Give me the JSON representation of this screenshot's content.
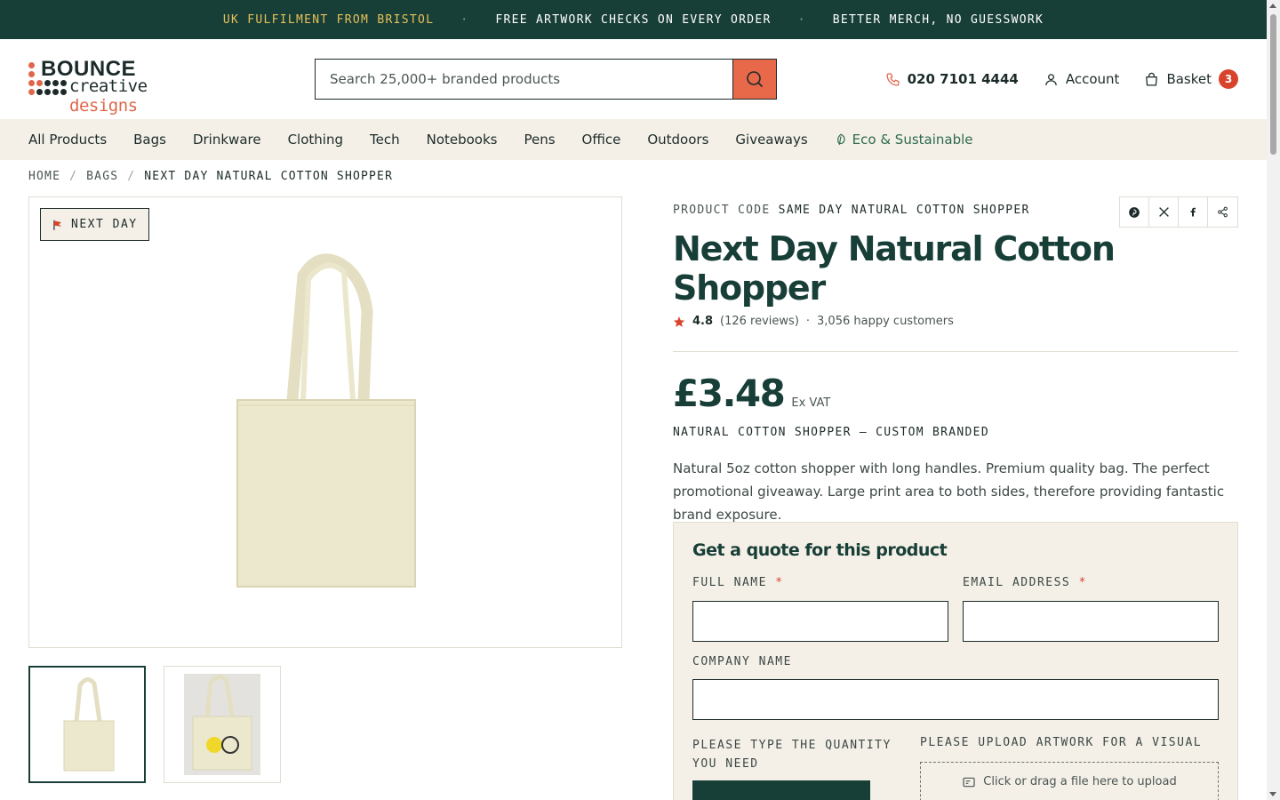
{
  "topbar": {
    "msg1": "UK FULFILMENT FROM BRISTOL",
    "sep": "·",
    "msg2": "FREE ARTWORK CHECKS ON EVERY ORDER",
    "msg3": "BETTER MERCH, NO GUESSWORK"
  },
  "header": {
    "logo_word1": "BOUNCE",
    "logo_word2": "creative",
    "logo_word3": "designs",
    "search_placeholder": "Search 25,000+ branded products",
    "phone": "020 7101 4444",
    "account": "Account",
    "basket": "Basket",
    "basket_count": "3"
  },
  "nav": {
    "items": [
      "All Products",
      "Bags",
      "Drinkware",
      "Clothing",
      "Tech",
      "Notebooks",
      "Pens",
      "Office",
      "Outdoors",
      "Giveaways"
    ],
    "eco": "Eco & Sustainable"
  },
  "breadcrumb": {
    "home": "HOME",
    "sep": "/",
    "bags": "BAGS",
    "current": "NEXT DAY NATURAL COTTON SHOPPER"
  },
  "gallery": {
    "badge": "NEXT DAY"
  },
  "product": {
    "code_label": "PRODUCT CODE",
    "code_value": "SAME DAY NATURAL COTTON SHOPPER",
    "title": "Next Day Natural Cotton Shopper",
    "rating": "4.8",
    "reviews": "(126 reviews)",
    "dot": "·",
    "customers": "3,056 happy customers",
    "price": "£3.48",
    "vat": "Ex VAT",
    "subtitle": "NATURAL COTTON SHOPPER — CUSTOM BRANDED",
    "description": "Natural 5oz cotton shopper with long handles. Premium quality bag. The perfect promotional giveaway. Large print area to both sides, therefore providing fantastic brand exposure."
  },
  "quote": {
    "heading": "Get a quote for this product",
    "full_name": "FULL NAME",
    "email": "EMAIL ADDRESS",
    "required": "*",
    "company": "COMPANY NAME",
    "quantity": "PLEASE TYPE THE QUANTITY YOU NEED",
    "artwork": "PLEASE UPLOAD ARTWORK FOR A VISUAL",
    "upload_text": "Click or drag a file here to upload"
  },
  "colors": {
    "brand_dark": "#173e37",
    "accent_orange": "#e8684a",
    "badge_red": "#d8432b",
    "cream": "#f4f0e7",
    "banner_gold": "#e6c15a"
  }
}
